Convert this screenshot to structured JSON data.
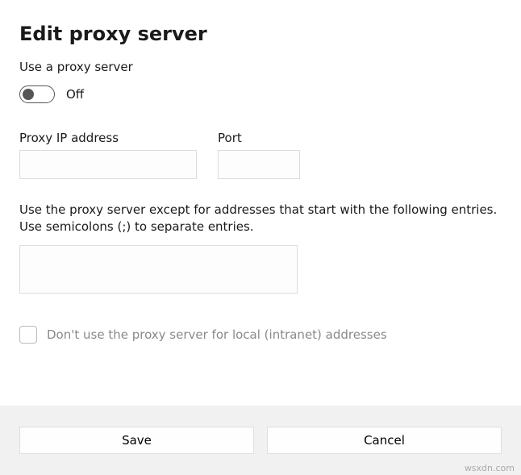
{
  "title": "Edit proxy server",
  "use_proxy": {
    "label": "Use a proxy server",
    "state": "Off"
  },
  "fields": {
    "ip": {
      "label": "Proxy IP address",
      "value": ""
    },
    "port": {
      "label": "Port",
      "value": ""
    }
  },
  "exceptions": {
    "label": "Use the proxy server except for addresses that start with the following entries. Use semicolons (;) to separate entries.",
    "value": ""
  },
  "local": {
    "label": "Don't use the proxy server for local (intranet) addresses",
    "checked": false
  },
  "buttons": {
    "save": "Save",
    "cancel": "Cancel"
  },
  "watermark": "wsxdn.com"
}
